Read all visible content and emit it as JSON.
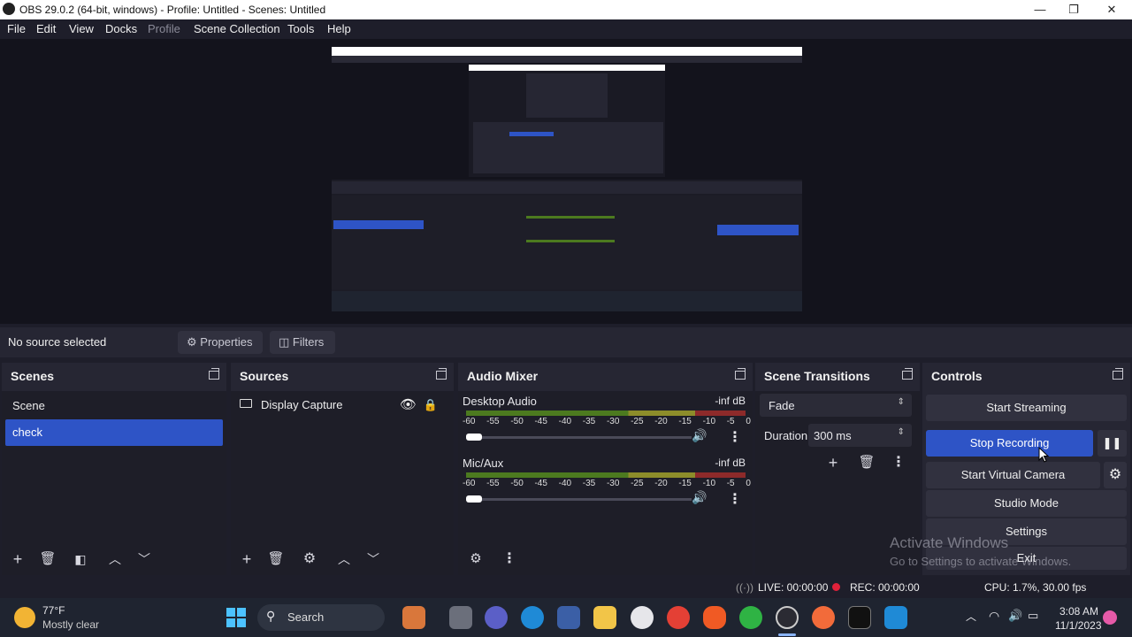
{
  "titlebar": {
    "title": "OBS 29.0.2 (64-bit, windows) - Profile: Untitled - Scenes: Untitled",
    "minimize": "—",
    "maximize": "❐",
    "close": "✕"
  },
  "menu": [
    "File",
    "Edit",
    "View",
    "Docks",
    "Profile",
    "Scene Collection",
    "Tools",
    "Help"
  ],
  "context": {
    "no_source": "No source selected",
    "properties": "Properties",
    "filters": "Filters"
  },
  "scenes": {
    "title": "Scenes",
    "items": [
      "Scene",
      "check"
    ]
  },
  "sources": {
    "title": "Sources",
    "items": [
      "Display Capture"
    ]
  },
  "audio_mixer": {
    "title": "Audio Mixer",
    "channels": [
      {
        "name": "Desktop Audio",
        "level": "-inf dB",
        "volume": 0.0
      },
      {
        "name": "Mic/Aux",
        "level": "-inf dB",
        "volume": 0.0
      }
    ],
    "ticks": [
      "-60",
      "-55",
      "-50",
      "-45",
      "-40",
      "-35",
      "-30",
      "-25",
      "-20",
      "-15",
      "-10",
      "-5",
      "0"
    ]
  },
  "scene_transitions": {
    "title": "Scene Transitions",
    "transition": "Fade",
    "duration_label": "Duration",
    "duration_value": "300 ms"
  },
  "controls": {
    "title": "Controls",
    "start_streaming": "Start Streaming",
    "stop_recording": "Stop Recording",
    "start_virtual_camera": "Start Virtual Camera",
    "studio_mode": "Studio Mode",
    "settings": "Settings",
    "exit": "Exit"
  },
  "watermark": {
    "line1": "Activate Windows",
    "line2": "Go to Settings to activate Windows."
  },
  "status": {
    "live": "LIVE: 00:00:00",
    "rec": "REC: 00:00:00",
    "cpu": "CPU: 1.7%, 30.00 fps"
  },
  "taskbar": {
    "weather_temp": "77°F",
    "weather_desc": "Mostly clear",
    "search": "Search",
    "time": "3:08 AM",
    "date": "11/1/2023"
  },
  "colors": {
    "accent": "#2e54c6",
    "rec_dot": "#e0213a"
  }
}
